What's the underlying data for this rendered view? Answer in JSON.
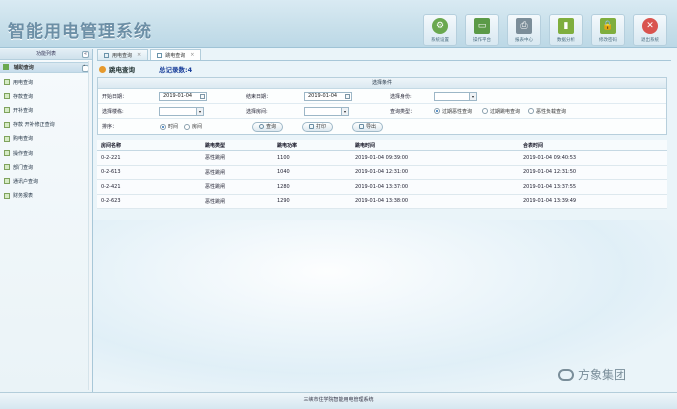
{
  "app": {
    "title": "智能用电管理系统",
    "footer": "三峡市住学院智能用电管理系统"
  },
  "toolbar": [
    {
      "label": "系统设置",
      "icon": "gear-icon",
      "color": "#6aa84f"
    },
    {
      "label": "操作平台",
      "icon": "monitor-icon",
      "color": "#6aa84f"
    },
    {
      "label": "报表中心",
      "icon": "printer-icon",
      "color": "#7b8d99"
    },
    {
      "label": "数据分析",
      "icon": "bar-chart-icon",
      "color": "#7fae3e"
    },
    {
      "label": "修改密码",
      "icon": "lock-icon",
      "color": "#7fae3e"
    },
    {
      "label": "退出系统",
      "icon": "power-icon",
      "color": "#d9544f"
    }
  ],
  "sidebar": {
    "header": "功能列表",
    "group": "辅助查询",
    "items": [
      {
        "label": "用电查询"
      },
      {
        "label": "存款查询"
      },
      {
        "label": "开补查询"
      },
      {
        "label": "存款 开补修正查询"
      },
      {
        "label": "购电查询"
      },
      {
        "label": "操作查询"
      },
      {
        "label": "部门查询"
      },
      {
        "label": "通讯户查询"
      },
      {
        "label": "财务报表"
      }
    ]
  },
  "tabs": [
    {
      "label": "用电查询",
      "close": "×"
    },
    {
      "label": "跳电查询",
      "close": "×"
    }
  ],
  "page": {
    "title": "跳电查询",
    "record_count": "总记录数:4"
  },
  "filter": {
    "header": "选择条件",
    "start_date_label": "开始日期：",
    "start_date": "2019-01-04",
    "end_date_label": "结束日期：",
    "end_date": "2019-01-04",
    "select_status_label": "选择身份:",
    "select_building_label": "选择楼栋:",
    "select_room_label": "选择房间:",
    "query_type_label": "查询类型：",
    "query_types": [
      "过期恶性查询",
      "过期跳电查询",
      "恶性负载查询"
    ],
    "sort_label": "排序：",
    "sort_options": [
      "时间",
      "房间"
    ],
    "query_button": "查询",
    "print_button": "打印",
    "export_button": "导出"
  },
  "table": {
    "columns": [
      "房间名称",
      "跳电类型",
      "跳电功率",
      "跳电时间",
      "合表时间"
    ],
    "rows": [
      [
        "0-2-221",
        "恶性跳闸",
        "1100",
        "2019-01-04 09:39:00",
        "2019-01-04 09:40:53"
      ],
      [
        "0-2-613",
        "恶性跳闸",
        "1040",
        "2019-01-04 12:31:00",
        "2019-01-04 12:31:50"
      ],
      [
        "0-2-421",
        "恶性跳闸",
        "1280",
        "2019-01-04 13:37:00",
        "2019-01-04 13:37:55"
      ],
      [
        "0-2-623",
        "恶性跳闸",
        "1290",
        "2019-01-04 13:38:00",
        "2019-01-04 13:39:49"
      ]
    ]
  },
  "watermark": "方象集团"
}
